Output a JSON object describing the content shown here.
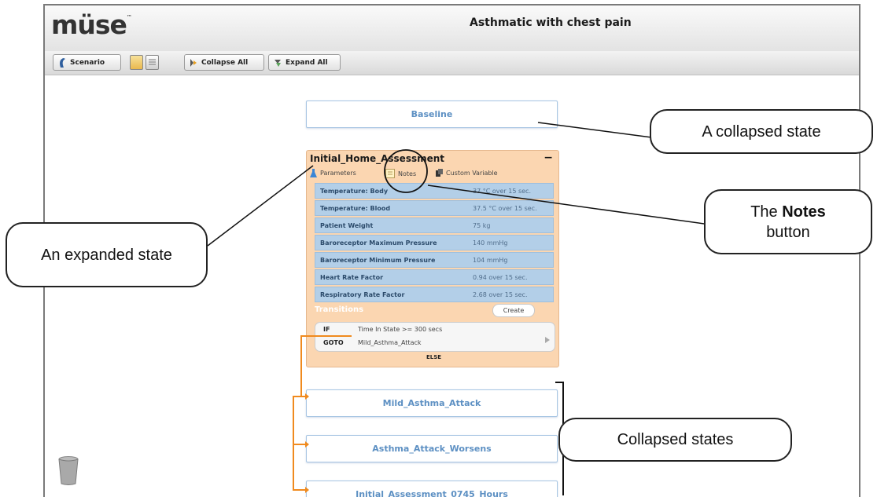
{
  "app": {
    "logo_text": "müse",
    "logo_tm": "™",
    "title": "Asthmatic with chest pain"
  },
  "toolbar": {
    "scenario_label": "Scenario",
    "collapse_label": "Collapse All",
    "expand_label": "Expand All"
  },
  "states": {
    "baseline": "Baseline",
    "expanded": {
      "title": "Initial_Home_Assessment",
      "tabs": {
        "parameters": "Parameters",
        "notes": "Notes",
        "custom": "Custom Variable"
      },
      "params": [
        {
          "name": "Temperature: Body",
          "value": "37 °C over 15 sec."
        },
        {
          "name": "Temperature: Blood",
          "value": "37.5 °C over 15 sec."
        },
        {
          "name": "Patient Weight",
          "value": "75 kg"
        },
        {
          "name": "Baroreceptor Maximum Pressure",
          "value": "140 mmHg"
        },
        {
          "name": "Baroreceptor Minimum Pressure",
          "value": "104 mmHg"
        },
        {
          "name": "Heart Rate Factor",
          "value": "0.94 over 15 sec."
        },
        {
          "name": "Respiratory Rate Factor",
          "value": "2.68 over 15 sec."
        }
      ],
      "transitions_label": "Transitions",
      "create_label": "Create",
      "if_keyword": "IF",
      "if_text": "Time In State >= 300 secs",
      "goto_keyword": "GOTO",
      "goto_text": "Mild_Asthma_Attack",
      "else_label": "ELSE"
    },
    "collapsed": [
      "Mild_Asthma_Attack",
      "Asthma_Attack_Worsens",
      "Initial_Assessment_0745_Hours"
    ]
  },
  "callouts": {
    "collapsed_state": "A collapsed state",
    "notes_prefix": "The",
    "notes_bold": "Notes",
    "notes_suffix": "button",
    "expanded_state": "An expanded state",
    "collapsed_states": "Collapsed states"
  },
  "colors": {
    "accent": "#2f7fd1",
    "state_border": "#a7c5e3",
    "expanded_bg": "#fbd6b1",
    "param_bg": "#b3cfe8",
    "link_orange": "#f08a1e"
  }
}
